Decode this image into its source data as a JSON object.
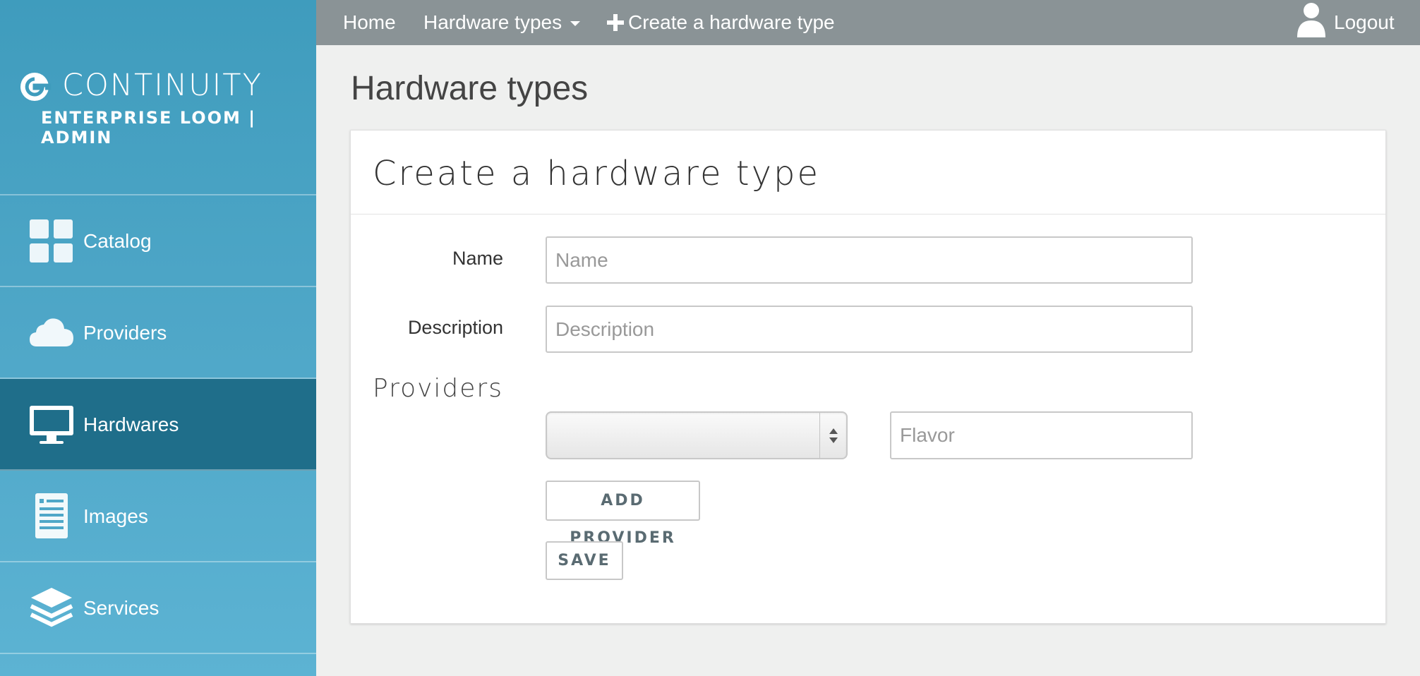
{
  "brand": {
    "name": "CONTINUITY",
    "subtitle": "ENTERPRISE LOOM | ADMIN"
  },
  "sidebar": {
    "items": [
      {
        "label": "Catalog",
        "icon": "grid-icon",
        "active": false
      },
      {
        "label": "Providers",
        "icon": "cloud-icon",
        "active": false
      },
      {
        "label": "Hardwares",
        "icon": "monitor-icon",
        "active": true
      },
      {
        "label": "Images",
        "icon": "document-icon",
        "active": false
      },
      {
        "label": "Services",
        "icon": "layers-icon",
        "active": false
      }
    ]
  },
  "topbar": {
    "home": "Home",
    "hardware_types": "Hardware types",
    "create": "Create a hardware type",
    "logout": "Logout"
  },
  "page": {
    "title": "Hardware types"
  },
  "form": {
    "title": "Create a hardware type",
    "name_label": "Name",
    "name_placeholder": "Name",
    "description_label": "Description",
    "description_placeholder": "Description",
    "providers_label": "Providers",
    "provider_selected": "",
    "flavor_placeholder": "Flavor",
    "add_provider": "ADD PROVIDER",
    "save": "SAVE"
  },
  "colors": {
    "sidebar_bg": "#4fa7c8",
    "sidebar_active": "#1f6e8a",
    "topbar_bg": "#8a9396",
    "page_bg": "#eff0ef"
  }
}
